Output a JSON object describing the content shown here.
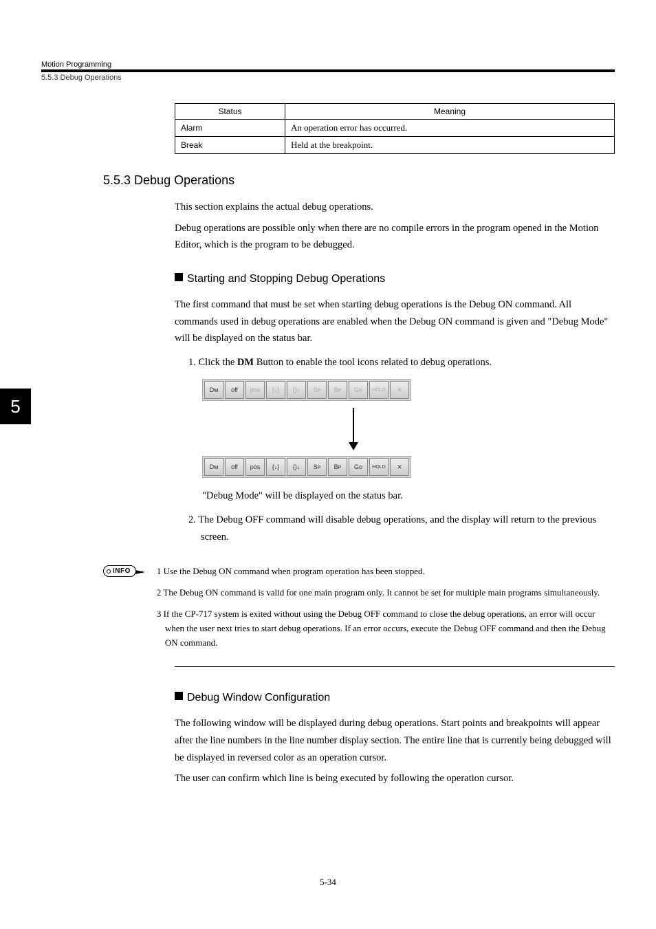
{
  "header": {
    "chapter": "Motion Programming",
    "subsection": "5.5.3  Debug Operations"
  },
  "table": {
    "h1": "Status",
    "h2": "Meaning",
    "rows": [
      {
        "c1": "Alarm",
        "c2": "An operation error has occurred."
      },
      {
        "c1": "Break",
        "c2": "Held at the breakpoint."
      }
    ]
  },
  "section": {
    "heading": "5.5.3  Debug Operations",
    "para1": "This section explains the actual debug operations.",
    "para2": "Debug operations are possible only when there are no compile errors in the program opened in the Motion Editor, which is the program to be debugged."
  },
  "sub1": {
    "title": "Starting and Stopping Debug Operations",
    "para": "The first command that must be set when starting debug operations is the Debug ON command. All commands used in debug operations are enabled when the Debug ON command is given and \"Debug Mode\" will be displayed on the status bar.",
    "step1_pre": "1.  Click the ",
    "step1_bold": "DM",
    "step1_post": " Button to enable the tool icons related to debug operations.",
    "step1_note": "\"Debug Mode\" will be displayed on the status bar.",
    "step2": "2.  The Debug OFF command will disable debug operations, and the display will return to the previous screen."
  },
  "toolbar": {
    "btns": [
      "Dᴍ",
      "off",
      "pos",
      "{↓}",
      "{}↓",
      "Sᴘ",
      "Bᴘ",
      "Gᴏ",
      "HOLD",
      "✕"
    ]
  },
  "info": {
    "label": "INFO",
    "items": [
      "1 Use the Debug ON command when program operation has been stopped.",
      "2 The Debug ON command is valid for one main program only. It cannot be set for multiple main programs simultaneously.",
      "3 If the CP-717 system is exited without using the Debug OFF command to close the debug operations, an error will occur when the user next tries to start debug operations. If an error occurs, execute the Debug OFF command and then the Debug ON command."
    ]
  },
  "sub2": {
    "title": "Debug Window Configuration",
    "para1": "The following window will be displayed during debug operations. Start points and breakpoints will appear after the line numbers in the line number display section. The entire line that is currently being debugged will be displayed in reversed color as an operation cursor.",
    "para2": "The user can confirm which line is being executed by following the operation cursor."
  },
  "tab": "5",
  "footer": "5-34"
}
